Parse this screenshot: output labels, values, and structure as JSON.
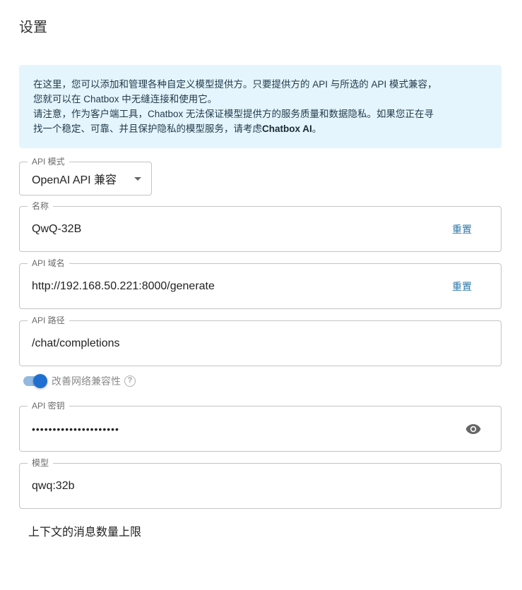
{
  "page": {
    "title": "设置"
  },
  "info": {
    "line1": "在这里，您可以添加和管理各种自定义模型提供方。只要提供方的 API 与所选的 API 模式兼容，",
    "line2": "您就可以在 Chatbox 中无缝连接和使用它。",
    "line3": "请注意，作为客户端工具，Chatbox 无法保证模型提供方的服务质量和数据隐私。如果您正在寻",
    "line4_prefix": "找一个稳定、可靠、并且保护隐私的模型服务，请考虑",
    "line4_bold": "Chatbox AI",
    "line4_suffix": "。"
  },
  "api_mode": {
    "label": "API 模式",
    "value": "OpenAI API 兼容"
  },
  "name_field": {
    "label": "名称",
    "value": "QwQ-32B",
    "reset_label": "重置"
  },
  "host_field": {
    "label": "API 域名",
    "value": "http://192.168.50.221:8000/generate",
    "reset_label": "重置"
  },
  "path_field": {
    "label": "API 路径",
    "value": "/chat/completions"
  },
  "network_toggle": {
    "label": "改善网络兼容性",
    "enabled": true,
    "help_glyph": "?"
  },
  "key_field": {
    "label": "API 密钥",
    "value": "•••••••••••••••••••••"
  },
  "model_field": {
    "label": "模型",
    "value": "qwq:32b"
  },
  "context_section": {
    "label": "上下文的消息数量上限"
  },
  "colors": {
    "info_bg": "#e5f5fd",
    "accent": "#1f6fd1",
    "link": "#2b78a8",
    "border": "#c4c4c4"
  },
  "icons": {
    "dropdown": "chevron-down-icon",
    "help": "help-circle-icon",
    "visibility": "eye-icon"
  }
}
